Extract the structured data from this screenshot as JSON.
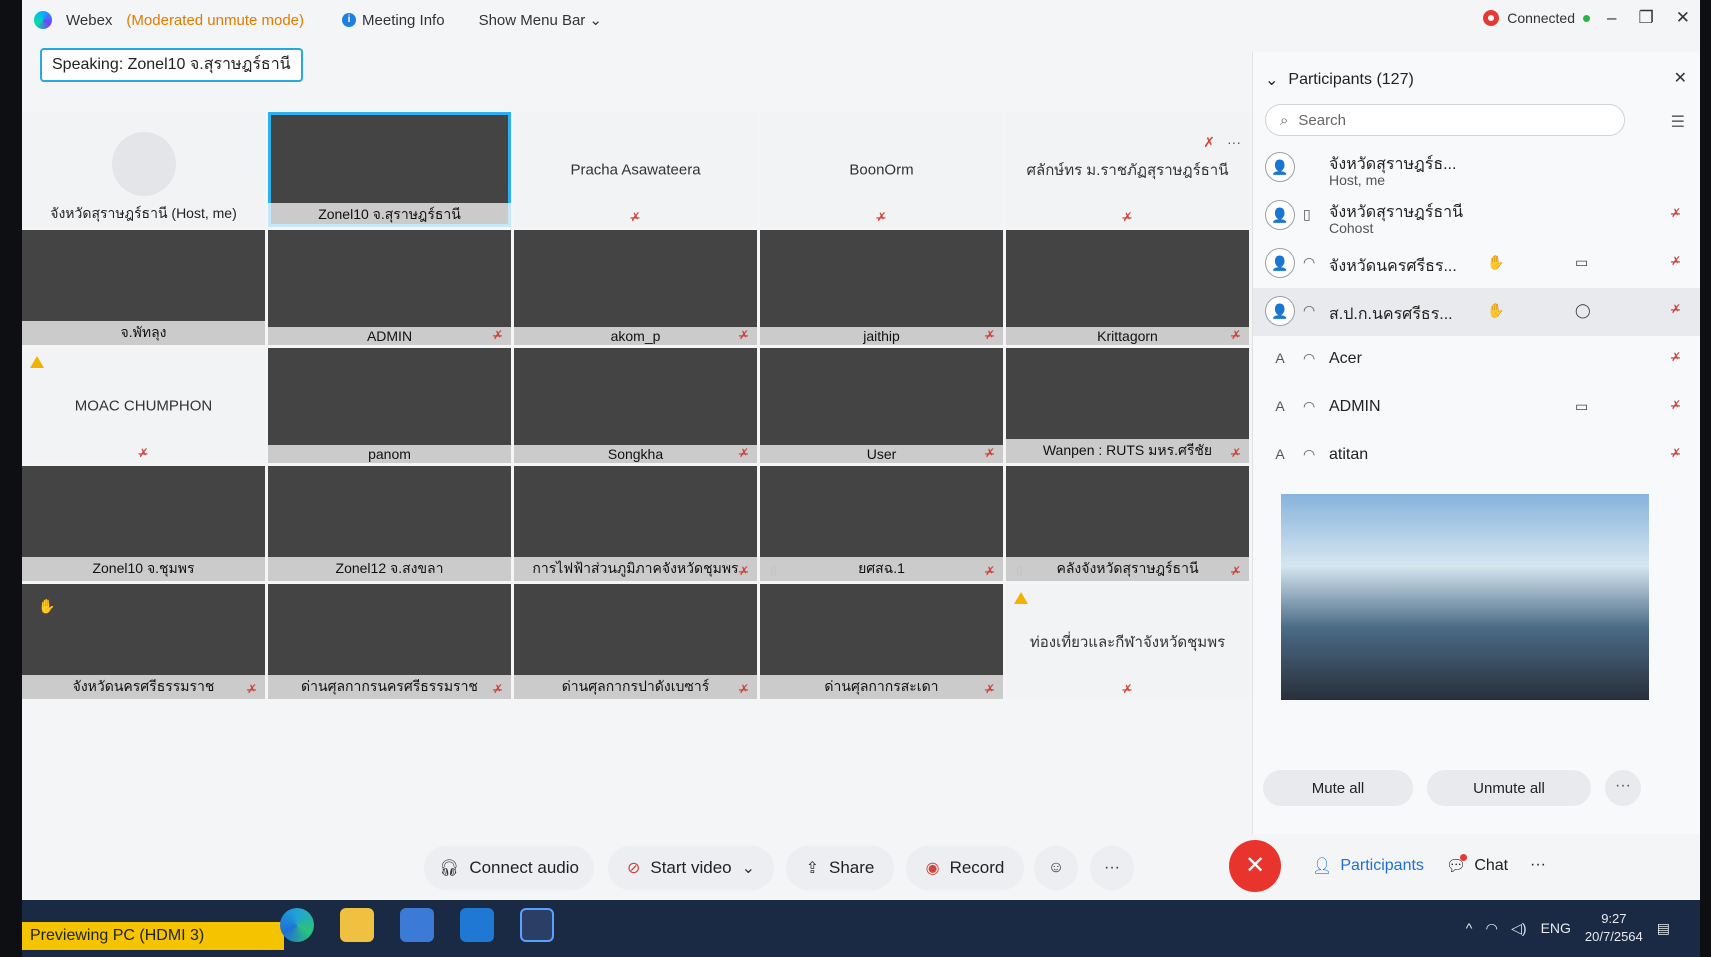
{
  "titlebar": {
    "app": "Webex",
    "mode": "(Moderated unmute mode)",
    "meeting_info": "Meeting Info",
    "show_menu_bar": "Show Menu Bar",
    "status": "Connected",
    "minimize": "–",
    "restore": "❐",
    "close": "✕"
  },
  "speaking": "Speaking: Zonel10 จ.สุราษฎร์ธานี",
  "tiles": [
    {
      "name": "จังหวัดสุราษฎร์ธานี (Host, me)",
      "layout": "avatar"
    },
    {
      "name": "Zonel10 จ.สุราษฎร์ธานี",
      "layout": "video",
      "active": true
    },
    {
      "name": "Pracha Asawateera",
      "layout": "center",
      "mute": "✗̶"
    },
    {
      "name": "BoonOrm",
      "layout": "center",
      "mute": "✗̶"
    },
    {
      "name": "ศลักษ์ทร ม.ราชภัฏสุราษฎร์ธานี",
      "layout": "center",
      "mute": "✗̶",
      "tools": true
    },
    {
      "name": "จ.พัทลุง",
      "layout": "video"
    },
    {
      "name": "ADMIN",
      "layout": "video",
      "mute": "✗̶"
    },
    {
      "name": "akom_p",
      "layout": "video",
      "mute": "✗̶"
    },
    {
      "name": "jaithip",
      "layout": "video",
      "mute": "✗̶"
    },
    {
      "name": "Krittagorn",
      "layout": "video",
      "mute": "✗̶"
    },
    {
      "name": "MOAC CHUMPHON",
      "layout": "center",
      "mute": "✗̶",
      "warn": true
    },
    {
      "name": "panom",
      "layout": "video"
    },
    {
      "name": "Songkha",
      "layout": "video",
      "mute": "✗̶"
    },
    {
      "name": "User",
      "layout": "video",
      "mute": "✗̶"
    },
    {
      "name": "Wanpen : RUTS มหร.ศรีชัย",
      "layout": "video",
      "mute": "✗̶"
    },
    {
      "name": "Zonel10 จ.ชุมพร",
      "layout": "video"
    },
    {
      "name": "Zonel12 จ.สงขลา",
      "layout": "video"
    },
    {
      "name": "การไฟฟ้าส่วนภูมิภาคจังหวัดชุมพร",
      "layout": "video",
      "mute": "✗̶"
    },
    {
      "name": "ยศสฉ.1",
      "layout": "video",
      "mute": "✗̶",
      "phone": true
    },
    {
      "name": "คลังจังหวัดสุราษฎร์ธานี",
      "layout": "video",
      "mute": "✗̶",
      "phone": true
    },
    {
      "name": "จังหวัดนครศรีธรรมราช",
      "layout": "video",
      "mute": "✗̶",
      "hand": true
    },
    {
      "name": "ด่านศุลกากรนครศรีธรรมราช",
      "layout": "video",
      "mute": "✗̶"
    },
    {
      "name": "ด่านศุลกากรปาดังเบซาร์",
      "layout": "video",
      "mute": "✗̶"
    },
    {
      "name": "ด่านศุลกากรสะเดา",
      "layout": "video",
      "mute": "✗̶"
    },
    {
      "name": "ท่องเที่ยวและกีฬาจังหวัดชุมพร",
      "layout": "center",
      "mute": "✗̶",
      "warn": true
    }
  ],
  "participants": {
    "title": "Participants (127)",
    "search_placeholder": "Search",
    "list": [
      {
        "name": "จังหวัดสุราษฎร์ธ...",
        "sub": "Host, me",
        "avatar": "👤"
      },
      {
        "name": "จังหวัดสุราษฎร์ธานี",
        "sub": "Cohost",
        "avatar": "👤",
        "mute": "✗̶"
      },
      {
        "name": "จังหวัดนครศรีธร...",
        "avatar": "👤",
        "hand": "✋",
        "cam": "▭",
        "mute": "✗̶"
      },
      {
        "name": "ส.ป.ก.นครศรีธร...",
        "avatar": "👤",
        "hand": "✋",
        "cam": "◯",
        "mute": "✗̶",
        "highlight": true
      },
      {
        "name": "Acer",
        "avatar": "A",
        "mute": "✗̶"
      },
      {
        "name": "ADMIN",
        "avatar": "A",
        "cam": "▭",
        "mute": "✗̶"
      },
      {
        "name": "atitan",
        "avatar": "A",
        "mute": "✗̶"
      }
    ],
    "mute_all": "Mute all",
    "unmute_all": "Unmute all"
  },
  "controls": {
    "connect_audio": "Connect audio",
    "start_video": "Start video",
    "share": "Share",
    "record": "Record",
    "participants": "Participants",
    "chat": "Chat"
  },
  "taskbar": {
    "preview": "Previewing PC (HDMI 3)",
    "lang": "ENG",
    "time": "9:27",
    "date": "20/7/2564"
  }
}
